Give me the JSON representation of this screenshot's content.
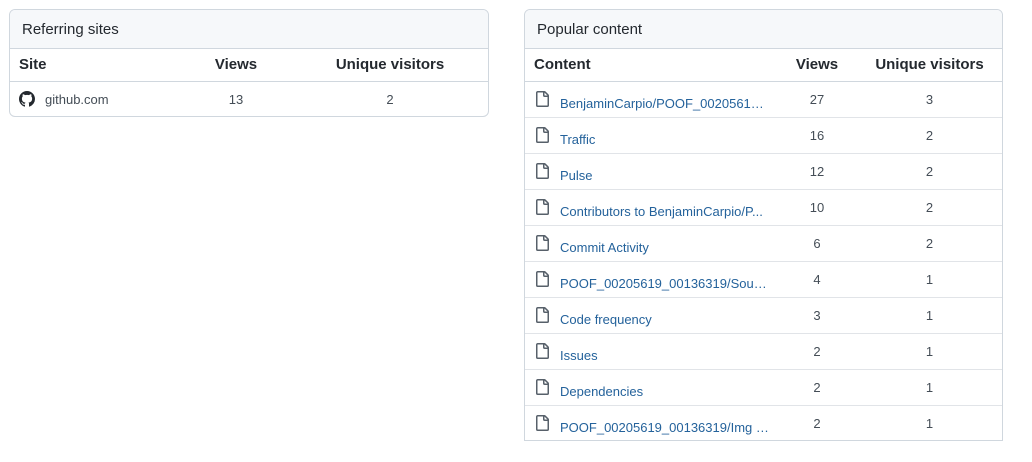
{
  "referring": {
    "title": "Referring sites",
    "columns": [
      "Site",
      "Views",
      "Unique visitors"
    ],
    "rows": [
      {
        "site": "github.com",
        "icon": "github-icon",
        "views": "13",
        "unique": "2"
      }
    ]
  },
  "popular": {
    "title": "Popular content",
    "columns": [
      "Content",
      "Views",
      "Unique visitors"
    ],
    "rows": [
      {
        "label": "BenjaminCarpio/POOF_00205619_...",
        "icon": "file-icon",
        "views": "27",
        "unique": "3"
      },
      {
        "label": "Traffic",
        "icon": "file-icon",
        "views": "16",
        "unique": "2"
      },
      {
        "label": "Pulse",
        "icon": "file-icon",
        "views": "12",
        "unique": "2"
      },
      {
        "label": "Contributors to BenjaminCarpio/P...",
        "icon": "file-icon",
        "views": "10",
        "unique": "2"
      },
      {
        "label": "Commit Activity",
        "icon": "file-icon",
        "views": "6",
        "unique": "2"
      },
      {
        "label": "POOF_00205619_00136319/Sourc...",
        "icon": "file-icon",
        "views": "4",
        "unique": "1"
      },
      {
        "label": "Code frequency",
        "icon": "file-icon",
        "views": "3",
        "unique": "1"
      },
      {
        "label": "Issues",
        "icon": "file-icon",
        "views": "2",
        "unique": "1"
      },
      {
        "label": "Dependencies",
        "icon": "file-icon",
        "views": "2",
        "unique": "1"
      },
      {
        "label": "POOF_00205619_00136319/Img a...",
        "icon": "file-icon",
        "views": "2",
        "unique": "1"
      }
    ]
  },
  "colors": {
    "link": "#24629b",
    "header_bg": "#f6f8fa",
    "border": "#d0d7de"
  }
}
